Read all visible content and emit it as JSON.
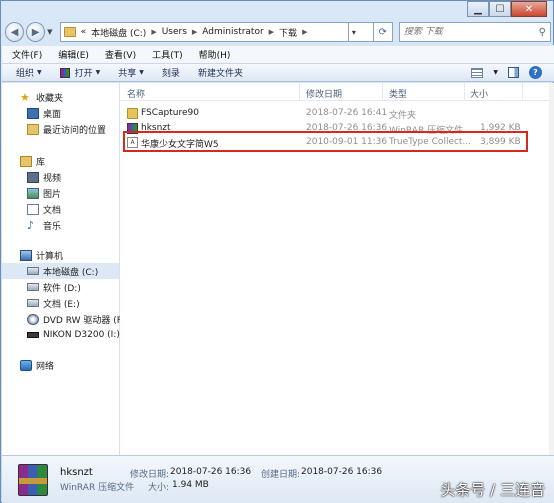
{
  "address": {
    "segments": [
      "本地磁盘 (C:)",
      "Users",
      "Administrator",
      "下载"
    ],
    "overflow": "«"
  },
  "search": {
    "placeholder": "搜索 下载"
  },
  "menu": [
    "文件(F)",
    "编辑(E)",
    "查看(V)",
    "工具(T)",
    "帮助(H)"
  ],
  "toolbar": {
    "organize": "组织",
    "open": "打开",
    "share": "共享",
    "burn": "刻录",
    "new_folder": "新建文件夹"
  },
  "nav": {
    "favorites": "收藏夹",
    "desktop": "桌面",
    "recent": "最近访问的位置",
    "libraries": "库",
    "videos": "视频",
    "pictures": "图片",
    "documents": "文档",
    "music": "音乐",
    "computer": "计算机",
    "drive_c": "本地磁盘 (C:)",
    "drive_d": "软件 (D:)",
    "drive_e": "文档 (E:)",
    "drive_f": "DVD RW 驱动器 (F:",
    "drive_i": "NIKON D3200 (I:)",
    "network": "网络"
  },
  "columns": {
    "name": "名称",
    "date": "修改日期",
    "type": "类型",
    "size": "大小"
  },
  "files": [
    {
      "name": "FSCapture90",
      "date": "2018-07-26 16:41",
      "type": "文件夹",
      "size": "",
      "icon": "folder-icon"
    },
    {
      "name": "hksnzt",
      "date": "2018-07-26 16:36",
      "type": "WinRAR 压缩文件",
      "size": "1,992 KB",
      "icon": "rar-icon"
    },
    {
      "name": "华康少女文字简W5",
      "date": "2010-09-01 11:36",
      "type": "TrueType Collect...",
      "size": "3,899 KB",
      "icon": "font-file-icon"
    }
  ],
  "details": {
    "name": "hksnzt",
    "type": "WinRAR 压缩文件",
    "modified_label": "修改日期:",
    "modified": "2018-07-26 16:36",
    "created_label": "创建日期:",
    "created": "2018-07-26 16:36",
    "size_label": "大小:",
    "size": "1.94 MB"
  },
  "watermark": "头条号 / 三连音",
  "colors": {
    "highlight_border": "#d42a1e",
    "selected_nav": "#dde8f6"
  }
}
